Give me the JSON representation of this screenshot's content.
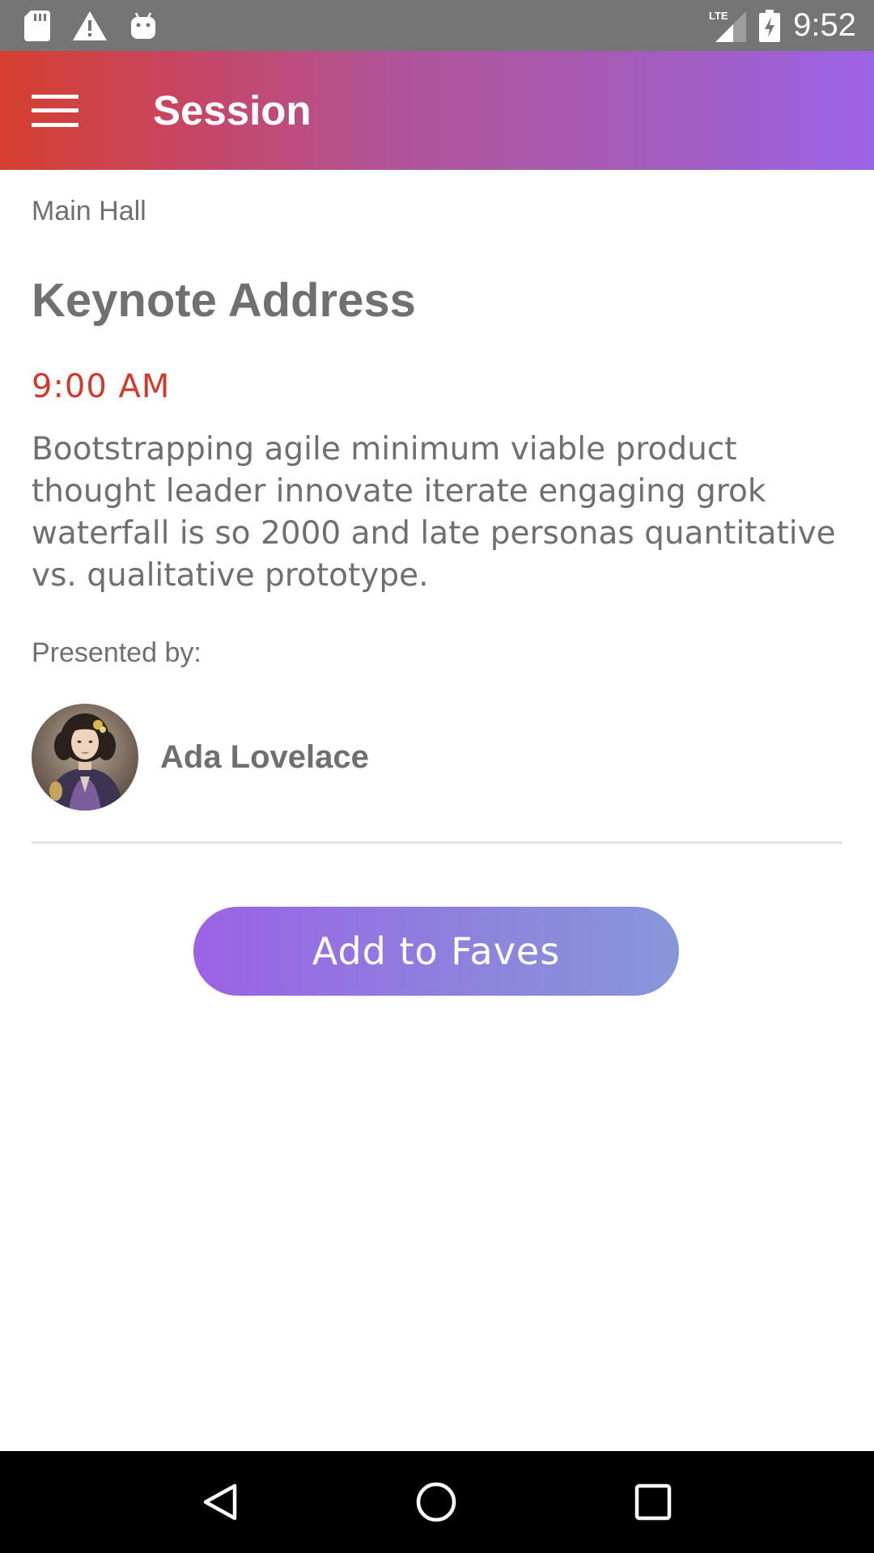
{
  "status_bar": {
    "time": "9:52",
    "left_icons": [
      "sd-card-icon",
      "warning-icon",
      "android-icon"
    ],
    "network": "LTE",
    "right_icons": [
      "lte-signal-icon",
      "battery-charging-icon"
    ]
  },
  "app_bar": {
    "title": "Session",
    "menu_icon": "hamburger-menu-icon",
    "gradient": [
      "#d63f2f",
      "#9b63e6"
    ]
  },
  "session": {
    "room": "Main Hall",
    "title": "Keynote Address",
    "time": "9:00 AM",
    "description": "Bootstrapping agile minimum viable product thought leader innovate iterate engaging grok waterfall is so 2000 and late personas quantitative vs. qualitative prototype.",
    "presented_by_label": "Presented by:",
    "speaker": {
      "name": "Ada Lovelace",
      "avatar_icon": "speaker-portrait"
    }
  },
  "actions": {
    "add_to_faves_label": "Add to Faves"
  },
  "nav_bar": {
    "buttons": [
      "back-icon",
      "home-icon",
      "recents-icon"
    ]
  },
  "colors": {
    "accent_time": "#d0392b",
    "text_gray": "#6f6f6f",
    "button_gradient": [
      "#9b62e6",
      "#8797d9"
    ]
  }
}
